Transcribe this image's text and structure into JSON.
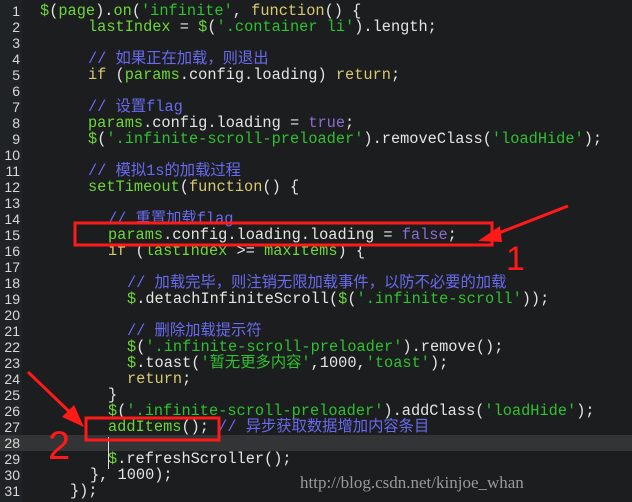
{
  "editor": {
    "lines": [
      {
        "n": "1",
        "indent": 0,
        "tokens": [
          [
            "$",
            "id"
          ],
          [
            "(",
            "pn"
          ],
          [
            "page",
            "id"
          ],
          [
            ").",
            "pn"
          ],
          [
            "on",
            "id"
          ],
          [
            "(",
            "pn"
          ],
          [
            "'infinite'",
            "str"
          ],
          [
            ", ",
            "pn"
          ],
          [
            "function",
            "fn"
          ],
          [
            "() {",
            "pn"
          ]
        ]
      },
      {
        "n": "2",
        "indent": 1,
        "tokens": [
          [
            "lastIndex",
            "id"
          ],
          [
            " = ",
            "pn"
          ],
          [
            "$",
            "id"
          ],
          [
            "(",
            "pn"
          ],
          [
            "'.container li'",
            "str"
          ],
          [
            ").length;",
            "pn"
          ]
        ]
      },
      {
        "n": "3",
        "indent": 1,
        "tokens": []
      },
      {
        "n": "4",
        "indent": 1,
        "tokens": [
          [
            "// 如果正在加载，则退出",
            "cm"
          ]
        ]
      },
      {
        "n": "5",
        "indent": 1,
        "tokens": [
          [
            "if",
            "kw"
          ],
          [
            " (",
            "pn"
          ],
          [
            "params",
            "id"
          ],
          [
            ".config.loading) ",
            "pn"
          ],
          [
            "return",
            "kw"
          ],
          [
            ";",
            "pn"
          ]
        ]
      },
      {
        "n": "6",
        "indent": 1,
        "tokens": []
      },
      {
        "n": "7",
        "indent": 1,
        "tokens": [
          [
            "// 设置flag",
            "cm"
          ]
        ]
      },
      {
        "n": "8",
        "indent": 1,
        "tokens": [
          [
            "params",
            "id"
          ],
          [
            ".config.loading = ",
            "pn"
          ],
          [
            "true",
            "bool"
          ],
          [
            ";",
            "pn"
          ]
        ]
      },
      {
        "n": "9",
        "indent": 1,
        "tokens": [
          [
            "$",
            "id"
          ],
          [
            "(",
            "pn"
          ],
          [
            "'.infinite-scroll-preloader'",
            "str"
          ],
          [
            ").removeClass(",
            "pn"
          ],
          [
            "'loadHide'",
            "str"
          ],
          [
            ");",
            "pn"
          ]
        ]
      },
      {
        "n": "10",
        "indent": 1,
        "tokens": []
      },
      {
        "n": "11",
        "indent": 1,
        "tokens": [
          [
            "// 模拟1s的加载过程",
            "cm"
          ]
        ]
      },
      {
        "n": "12",
        "indent": 1,
        "tokens": [
          [
            "setTimeout",
            "id"
          ],
          [
            "(",
            "pn"
          ],
          [
            "function",
            "fn"
          ],
          [
            "() {",
            "pn"
          ]
        ]
      },
      {
        "n": "13",
        "indent": 2,
        "tokens": []
      },
      {
        "n": "14",
        "indent": 2,
        "tokens": [
          [
            "// 重置加载flag",
            "cm"
          ]
        ]
      },
      {
        "n": "15",
        "indent": 2,
        "tokens": [
          [
            "params",
            "id"
          ],
          [
            ".config.loading.loading = ",
            "pn"
          ],
          [
            "false",
            "bool"
          ],
          [
            ";",
            "pn"
          ]
        ]
      },
      {
        "n": "16",
        "indent": 2,
        "tokens": [
          [
            "if",
            "kw"
          ],
          [
            " (",
            "pn"
          ],
          [
            "lastIndex",
            "id"
          ],
          [
            " >= ",
            "pn"
          ],
          [
            "maxItems",
            "id"
          ],
          [
            ") {",
            "pn"
          ]
        ]
      },
      {
        "n": "17",
        "indent": 3,
        "tokens": []
      },
      {
        "n": "18",
        "indent": 3,
        "tokens": [
          [
            "// 加载完毕，则注销无限加载事件，以防不必要的加载",
            "cm"
          ]
        ]
      },
      {
        "n": "19",
        "indent": 3,
        "tokens": [
          [
            "$",
            "id"
          ],
          [
            ".detachInfiniteScroll(",
            "pn"
          ],
          [
            "$",
            "id"
          ],
          [
            "(",
            "pn"
          ],
          [
            "'.infinite-scroll'",
            "str"
          ],
          [
            "));",
            "pn"
          ]
        ]
      },
      {
        "n": "20",
        "indent": 3,
        "tokens": []
      },
      {
        "n": "21",
        "indent": 3,
        "tokens": [
          [
            "// 删除加载提示符",
            "cm"
          ]
        ]
      },
      {
        "n": "22",
        "indent": 3,
        "tokens": [
          [
            "$",
            "id"
          ],
          [
            "(",
            "pn"
          ],
          [
            "'.infinite-scroll-preloader'",
            "str"
          ],
          [
            ").remove();",
            "pn"
          ]
        ]
      },
      {
        "n": "23",
        "indent": 3,
        "tokens": [
          [
            "$",
            "id"
          ],
          [
            ".toast(",
            "pn"
          ],
          [
            "'暂无更多内容'",
            "str"
          ],
          [
            ",1000,",
            "pn"
          ],
          [
            "'toast'",
            "str"
          ],
          [
            ");",
            "pn"
          ]
        ]
      },
      {
        "n": "24",
        "indent": 3,
        "tokens": [
          [
            "return",
            "kw"
          ],
          [
            ";",
            "pn"
          ]
        ]
      },
      {
        "n": "25",
        "indent": 2,
        "tokens": [
          [
            "}",
            "pn"
          ]
        ]
      },
      {
        "n": "26",
        "indent": 2,
        "tokens": [
          [
            "$",
            "id"
          ],
          [
            "(",
            "pn"
          ],
          [
            "'.infinite-scroll-preloader'",
            "str"
          ],
          [
            ").addClass(",
            "pn"
          ],
          [
            "'loadHide'",
            "str"
          ],
          [
            ");",
            "pn"
          ]
        ]
      },
      {
        "n": "27",
        "indent": 2,
        "tokens": [
          [
            "addItems",
            "id"
          ],
          [
            "(); ",
            "pn"
          ],
          [
            "// 异步获取数据增加内容条目",
            "cm"
          ]
        ]
      },
      {
        "n": "28",
        "indent": 2,
        "tokens": [],
        "active": true
      },
      {
        "n": "29",
        "indent": 2,
        "tokens": [
          [
            "$",
            "id"
          ],
          [
            ".refreshScroller();",
            "pn"
          ]
        ]
      },
      {
        "n": "30",
        "indent": 4,
        "tokens": [
          [
            "}, 1000);",
            "pn"
          ]
        ]
      },
      {
        "n": "31",
        "indent": 5,
        "tokens": [
          [
            "});",
            "pn"
          ]
        ]
      }
    ]
  },
  "annotations": {
    "color": "#ff1a1a",
    "label_1": "1",
    "label_2": "2"
  },
  "watermark": "http://blog.csdn.net/kinjoe_whan"
}
